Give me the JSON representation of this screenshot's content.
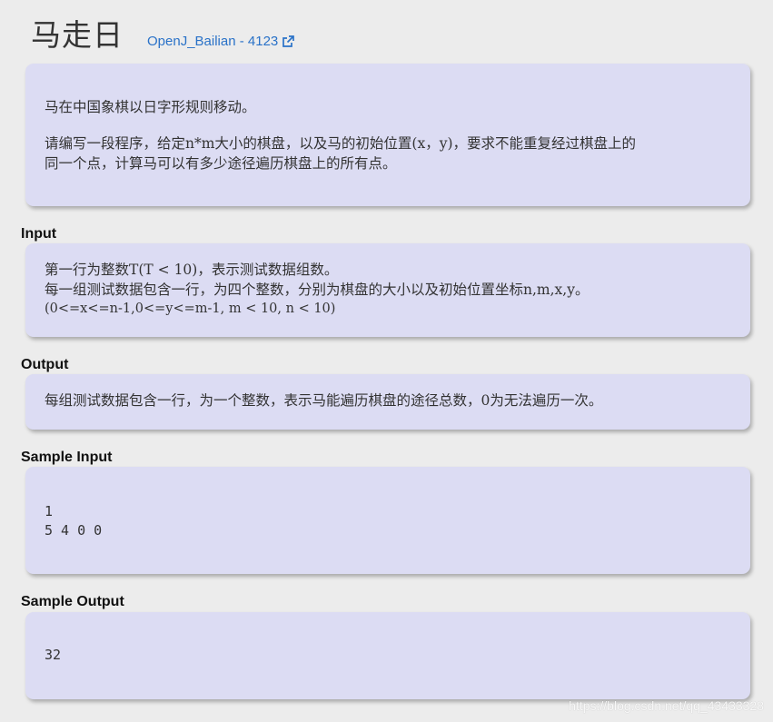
{
  "header": {
    "title": "马走日",
    "source_link": "OpenJ_Bailian - 4123"
  },
  "description": {
    "line1": "马在中国象棋以日字形规则移动。",
    "line2": "请编写一段程序，给定n*m大小的棋盘，以及马的初始位置(x，y)，要求不能重复经过棋盘上的",
    "line3": "同一个点，计算马可以有多少途径遍历棋盘上的所有点。"
  },
  "input": {
    "label": "Input",
    "lines": [
      "第一行为整数T(T < 10)，表示测试数据组数。",
      "每一组测试数据包含一行，为四个整数，分别为棋盘的大小以及初始位置坐标n,m,x,y。",
      "(0<=x<=n-1,0<=y<=m-1, m < 10, n < 10)"
    ]
  },
  "output": {
    "label": "Output",
    "lines": [
      "每组测试数据包含一行，为一个整数，表示马能遍历棋盘的途径总数，0为无法遍历一次。"
    ]
  },
  "sample_input": {
    "label": "Sample Input",
    "lines": [
      "1",
      "5 4 0 0"
    ]
  },
  "sample_output": {
    "label": "Sample Output",
    "lines": [
      "32"
    ]
  },
  "watermark": "https://blog.csdn.net/qq_43433328",
  "colors": {
    "background": "#ececec",
    "panel": "#dcdcf3",
    "link": "#2a72c8"
  },
  "icons": {
    "source_link_icon": "external-link-icon"
  }
}
